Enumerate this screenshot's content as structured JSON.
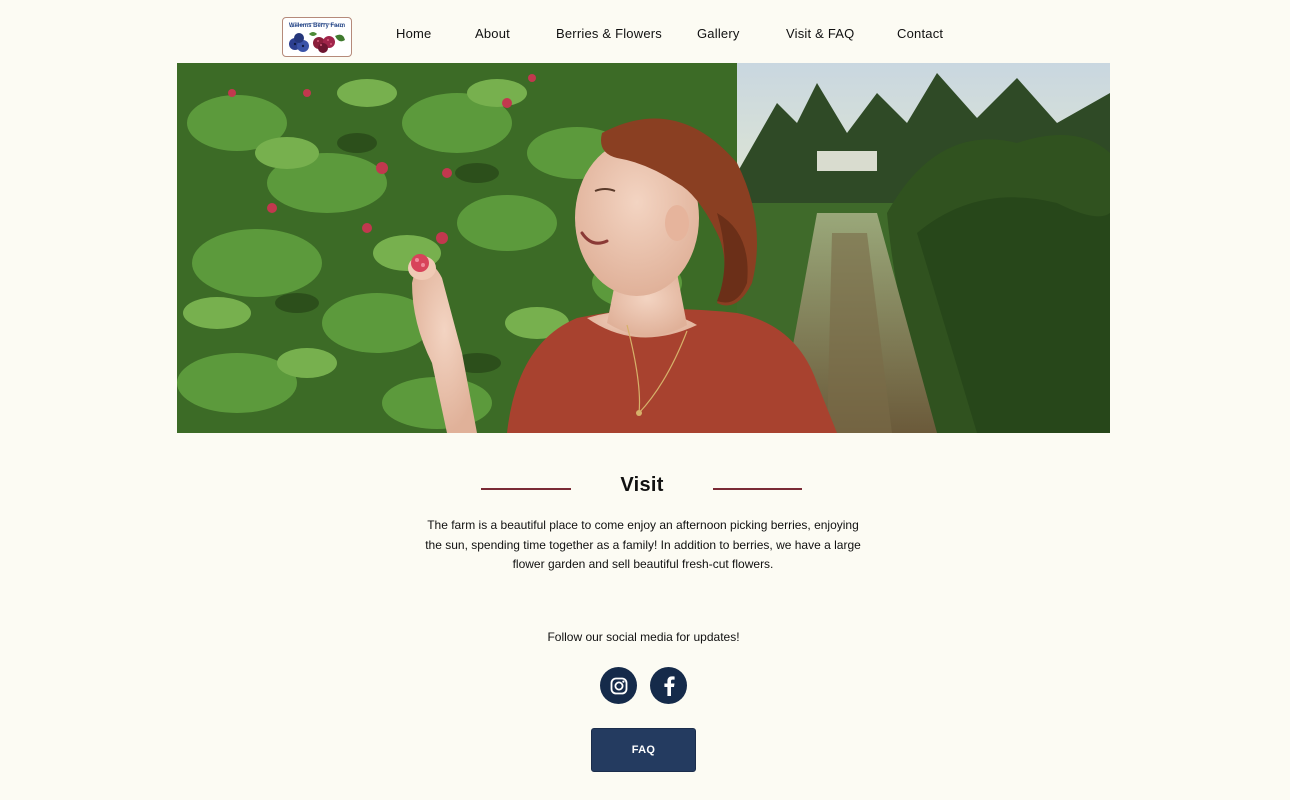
{
  "brand": {
    "logo_text": "Willems Berry Farm"
  },
  "nav": {
    "items": [
      {
        "label": "Home"
      },
      {
        "label": "About"
      },
      {
        "label": "Berries & Flowers"
      },
      {
        "label": "Gallery"
      },
      {
        "label": "Visit & FAQ"
      },
      {
        "label": "Contact"
      }
    ]
  },
  "hero": {
    "image": "woman-picking-raspberries-photo"
  },
  "visit": {
    "title": "Visit",
    "text": "The farm is a beautiful place to come enjoy an afternoon picking berries, enjoying the sun, spending time together as a family! In addition to berries, we have a large flower garden and sell beautiful fresh-cut flowers."
  },
  "social": {
    "text": "Follow our social media for updates!",
    "icons": [
      "instagram-icon",
      "facebook-icon"
    ]
  },
  "faq_button": {
    "label": "FAQ"
  },
  "colors": {
    "background": "#fcfbf3",
    "accent_rule": "#7a2a35",
    "button": "#243b60",
    "social_circle": "#152a4a"
  }
}
